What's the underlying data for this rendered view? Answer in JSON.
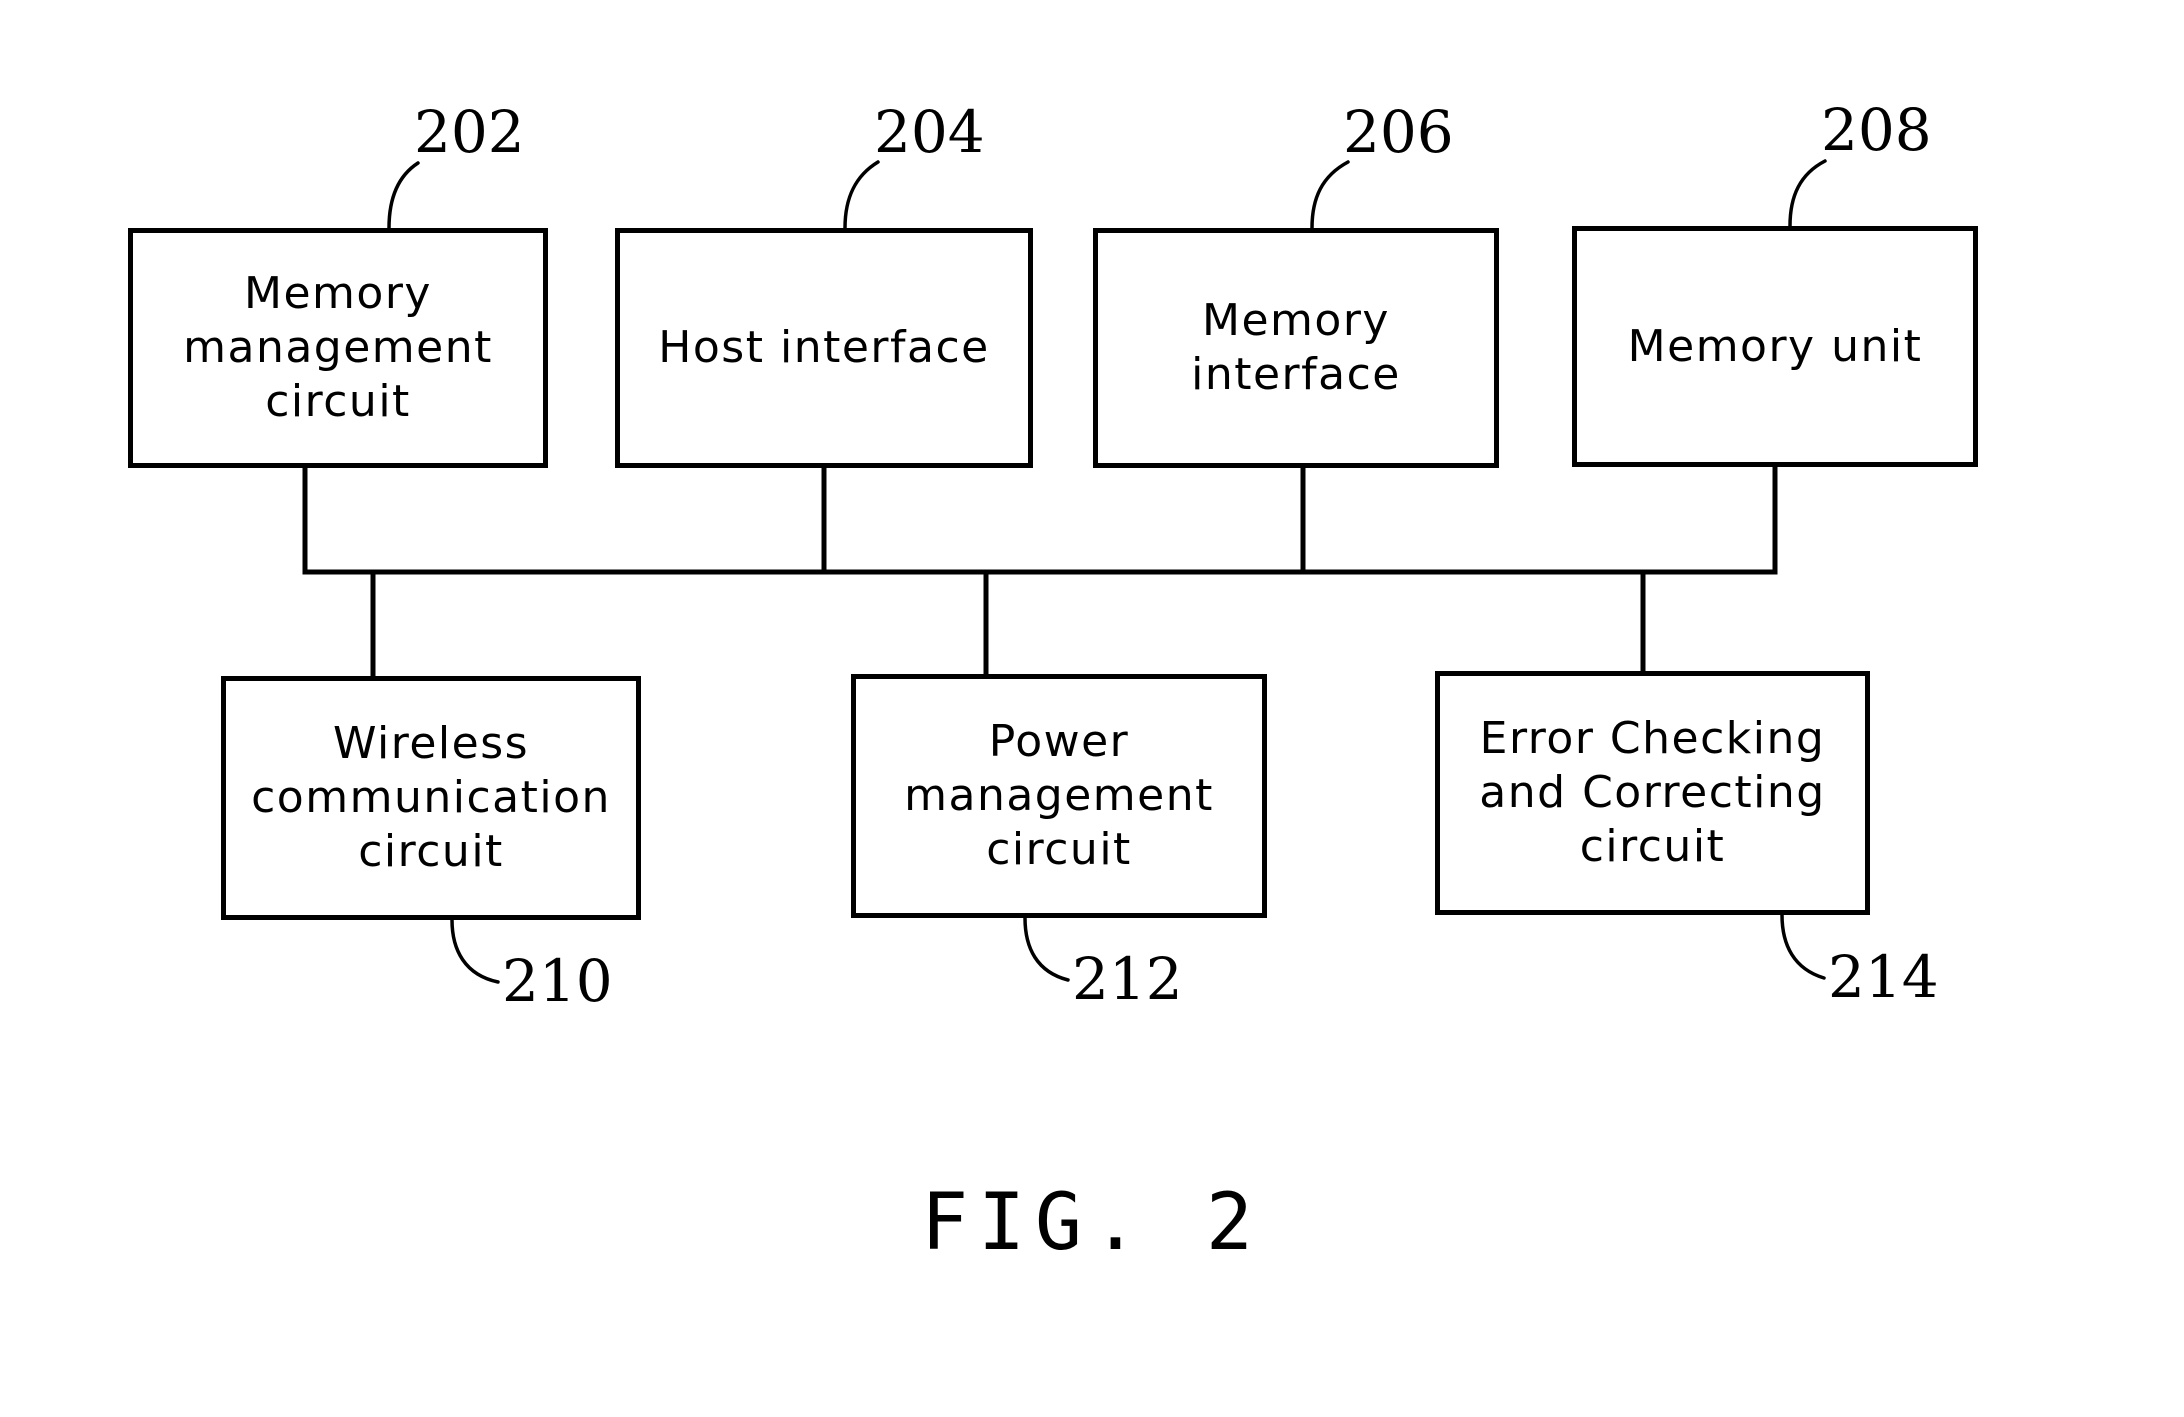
{
  "figure": {
    "caption": "FIG. 2",
    "type": "patent-block-diagram"
  },
  "colors": {
    "stroke": "#000000",
    "background": "#ffffff"
  },
  "nodes": [
    {
      "id": "memory-management-circuit",
      "label": "Memory\nmanagement\ncircuit",
      "ref": "202"
    },
    {
      "id": "host-interface",
      "label": "Host interface",
      "ref": "204"
    },
    {
      "id": "memory-interface",
      "label": "Memory interface",
      "ref": "206"
    },
    {
      "id": "memory-unit",
      "label": "Memory unit",
      "ref": "208"
    },
    {
      "id": "wireless-communication-circuit",
      "label": "Wireless\ncommunication\ncircuit",
      "ref": "210"
    },
    {
      "id": "power-management-circuit",
      "label": "Power\nmanagement\ncircuit",
      "ref": "212"
    },
    {
      "id": "error-checking-and-correcting-circuit",
      "label": "Error Checking\nand Correcting\ncircuit",
      "ref": "214"
    }
  ],
  "connections": {
    "bus_description": "All seven blocks join a common horizontal bus line.",
    "top_row_refs": [
      "202",
      "204",
      "206",
      "208"
    ],
    "bottom_row_refs": [
      "210",
      "212",
      "214"
    ]
  }
}
